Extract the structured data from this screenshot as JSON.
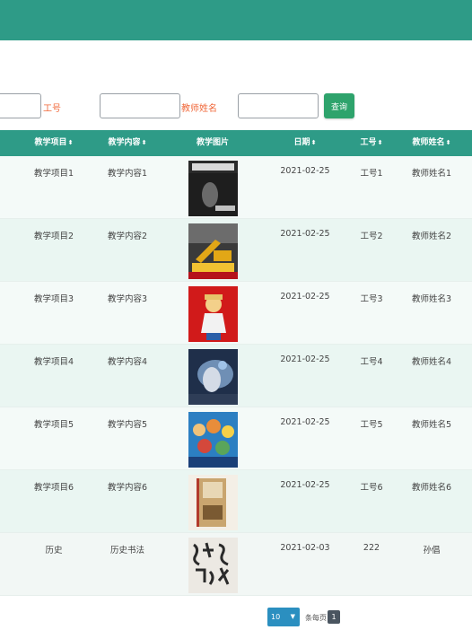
{
  "search": {
    "field_labels": [
      "工号",
      "教师姓名"
    ],
    "query_button": "查询"
  },
  "table": {
    "headers": {
      "project": "教学项目",
      "content": "教学内容",
      "picture": "教学图片",
      "date": "日期",
      "id": "工号",
      "name": "教师姓名"
    },
    "sort_glyph": "⬍",
    "rows": [
      {
        "project": "教学项目1",
        "content": "教学内容1",
        "date": "2021-02-25",
        "id": "工号1",
        "name": "教师姓名1",
        "picture": "book-cover-image"
      },
      {
        "project": "教学项目2",
        "content": "教学内容2",
        "date": "2021-02-25",
        "id": "工号2",
        "name": "教师姓名2",
        "picture": "excavator-book-image"
      },
      {
        "project": "教学项目3",
        "content": "教学内容3",
        "date": "2021-02-25",
        "id": "工号3",
        "name": "教师姓名3",
        "picture": "anime-character-image"
      },
      {
        "project": "教学项目4",
        "content": "教学内容4",
        "date": "2021-02-25",
        "id": "工号4",
        "name": "教师姓名4",
        "picture": "fantasy-art-image"
      },
      {
        "project": "教学项目5",
        "content": "教学内容5",
        "date": "2021-02-25",
        "id": "工号5",
        "name": "教师姓名5",
        "picture": "anime-group-image"
      },
      {
        "project": "教学项目6",
        "content": "教学内容6",
        "date": "2021-02-25",
        "id": "工号6",
        "name": "教师姓名6",
        "picture": "book-cover-image"
      },
      {
        "project": "历史",
        "content": "历史书法",
        "date": "2021-02-03",
        "id": "222",
        "name": "孙倡",
        "picture": "calligraphy-image"
      }
    ]
  },
  "pagination": {
    "page_size": "10",
    "per_page_label": "条每页",
    "current_page": "1"
  },
  "colors": {
    "header_bg": "#2e9b87",
    "query_button": "#2ea36c",
    "label_text": "#f0683a",
    "page_size_select": "#2b8fc0"
  }
}
